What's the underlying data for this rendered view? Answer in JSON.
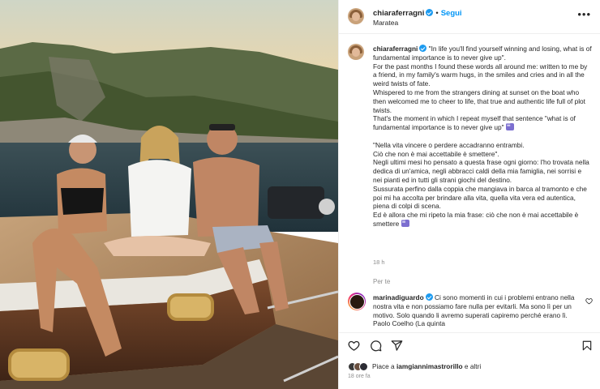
{
  "post": {
    "username": "chiaraferragni",
    "follow_label": "Segui",
    "location": "Maratea",
    "caption_user": "chiaraferragni",
    "caption_text_1": " \"In life you'll find yourself winning and losing, what is of fundamental importance is to never give up\".\nFor the past months I found these words all around me: written to me by a friend, in my family's warm hugs, in the smiles and cries and in all the weird twists of fate.\nWhispered to me from the strangers dining at sunset on the boat who then welcomed me to cheer to life, that true and authentic life full of plot twists.\nThat's the moment in which I repeat myself that sentence \"what is of fundamental importance is to never give up\" ",
    "caption_text_2": "\n\n\"Nella vita vincere o perdere accadranno entrambi.\nCiò che non è mai accettabile è smettere\".\nNegli ultimi mesi ho pensato a questa frase ogni giorno: l'ho trovata nella dedica di un'amica, negli abbracci caldi della mia famiglia, nei sorrisi e nei pianti ed in tutti gli strani giochi del destino.\nSussurata perfino dalla coppia che mangiava in barca al tramonto e che poi mi ha accolta per brindare alla vita, quella vita vera ed autentica, piena di colpi di scena.\nEd è allora che mi ripeto la mia frase: ciò che non è mai accettabile è smettere ",
    "caption_time": "18 h",
    "translate_label": "Per te",
    "like_summary_prefix": "Piace a ",
    "like_summary_user": "iamgiannimastrorillo",
    "like_summary_suffix": " e altri",
    "time_ago": "18 ore fa"
  },
  "comment": {
    "username": "marinadiguardo",
    "text": " Ci sono momenti in cui i problemi entrano nella nostra vita e non possiamo fare nulla per evitarli. Ma sono lì per un motivo. Solo quando li avremo superati capiremo perché erano lì. Paolo Coelho (La quinta"
  },
  "icons": {
    "more": "more-options-icon",
    "verified": "verified-badge-icon",
    "like": "heart-icon",
    "comment": "comment-icon",
    "share": "share-icon",
    "save": "bookmark-icon",
    "emoji": "memo-emoji-icon"
  },
  "colors": {
    "follow": "#0095f6",
    "verified": "#1d9bf0",
    "secondary_text": "#8e8e8e"
  }
}
